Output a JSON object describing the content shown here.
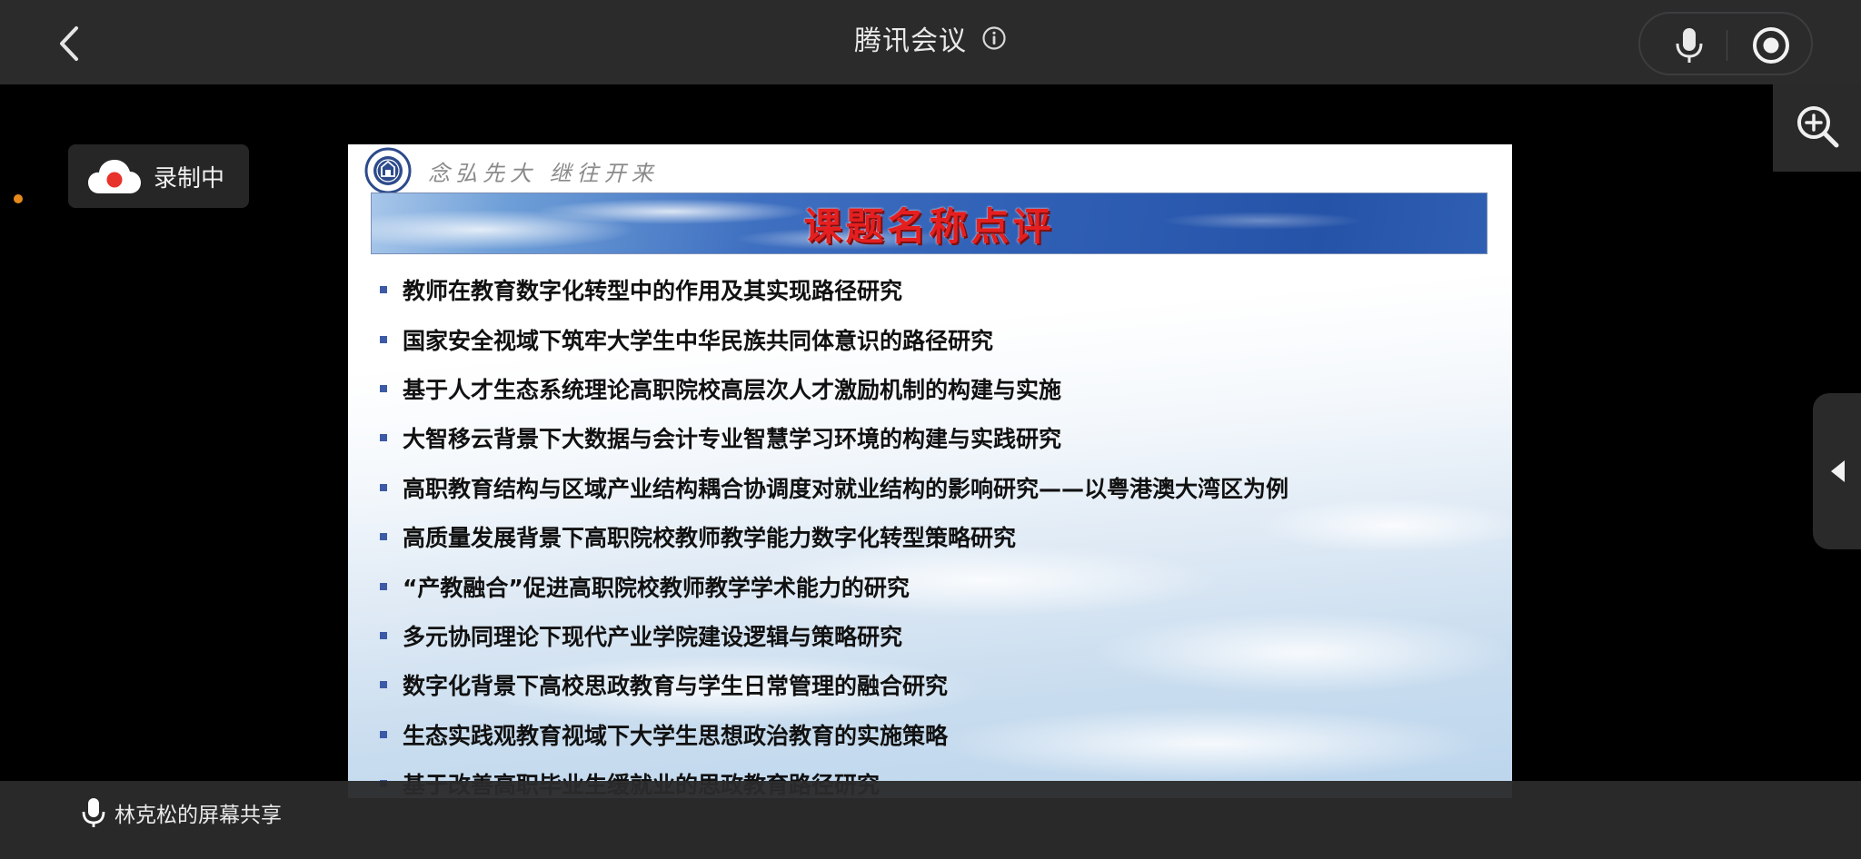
{
  "header": {
    "title": "腾讯会议"
  },
  "recording": {
    "label": "录制中"
  },
  "slide": {
    "motto": "念弘先大 继往开来",
    "banner_title": "课题名称点评",
    "topics": [
      "教师在教育数字化转型中的作用及其实现路径研究",
      "国家安全视域下筑牢大学生中华民族共同体意识的路径研究",
      "基于人才生态系统理论高职院校高层次人才激励机制的构建与实施",
      "大智移云背景下大数据与会计专业智慧学习环境的构建与实践研究",
      "高职教育结构与区域产业结构耦合协调度对就业结构的影响研究——以粤港澳大湾区为例",
      "高质量发展背景下高职院校教师教学能力数字化转型策略研究",
      "“产教融合”促进高职院校教师教学学术能力的研究",
      "多元协同理论下现代产业学院建设逻辑与策略研究",
      "数字化背景下高校思政教育与学生日常管理的融合研究",
      "生态实践观教育视域下大学生思想政治教育的实施策略",
      "基于改善高职毕业生缓就业的思政教育路径研究"
    ]
  },
  "footer": {
    "share_label": "林克松的屏幕共享"
  },
  "icons": {
    "back": "chevron-left-icon",
    "info": "info-icon",
    "mic": "microphone-icon",
    "record": "record-icon",
    "zoom": "zoom-in-icon",
    "collapse": "triangle-left-icon",
    "cloud": "cloud-record-icon"
  },
  "colors": {
    "topbar_bg": "#2b2b2c",
    "banner_title": "#e51f1f",
    "bullet": "#3c5aa6",
    "orange_dot": "#e78a1c",
    "record_red": "#e8322c"
  }
}
